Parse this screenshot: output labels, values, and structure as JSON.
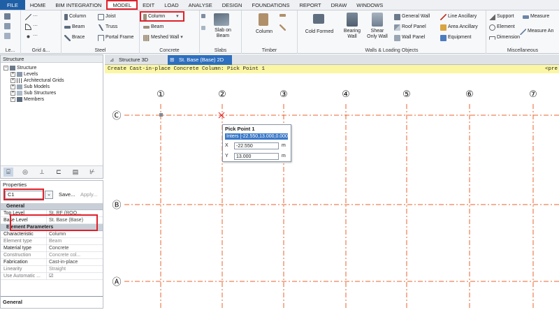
{
  "menu": {
    "tabs": [
      "FILE",
      "HOME",
      "BIM INTEGRATION",
      "MODEL",
      "EDIT",
      "LOAD",
      "ANALYSE",
      "DESIGN",
      "FOUNDATIONS",
      "REPORT",
      "DRAW",
      "WINDOWS"
    ],
    "active": "MODEL"
  },
  "ribbon": {
    "groups": {
      "levels": "Le...",
      "grid": "Grid &...",
      "steel": "Steel",
      "concrete": "Concrete",
      "slabs": "Slabs",
      "timber": "Timber",
      "walls": "Walls & Loading Objects",
      "misc": "Miscellaneous"
    },
    "steel": {
      "column": "Column",
      "beam": "Beam",
      "brace": "Brace",
      "joist": "Joist",
      "truss": "Truss",
      "portal": "Portal Frame"
    },
    "concrete": {
      "column": "Column",
      "beam": "Beam",
      "wall": "Meshed Wall"
    },
    "slabs": {
      "slab_on_beam": "Slab on\nBeam"
    },
    "timber": {
      "column": "Column"
    },
    "walls": {
      "cold_formed": "Cold Formed",
      "bearing": "Bearing\nWall",
      "shear": "Shear\nOnly Wall",
      "general_wall": "General Wall",
      "roof_panel": "Roof Panel",
      "wall_panel": "Wall Panel",
      "line_ancillary": "Line Ancillary",
      "area_ancillary": "Area Ancillary",
      "equipment": "Equipment"
    },
    "misc": {
      "support": "Support",
      "element": "Element",
      "dimension": "Dimension",
      "measure": "Measure",
      "measure_an": "Measure An"
    }
  },
  "structure_panel": {
    "title": "Structure",
    "items": [
      "Structure",
      "Levels",
      "Architectural Grids",
      "Sub Models",
      "Sub Structures",
      "Members"
    ]
  },
  "doc_tabs": [
    "Structure 3D",
    "St. Base (Base) 2D"
  ],
  "command": {
    "prompt": "Create Cast-in-place Concrete Column: Pick Point 1",
    "right": "<pre"
  },
  "properties": {
    "title": "Properties",
    "selected": "C1",
    "save": "Save...",
    "apply": "Apply...",
    "sec_general": "General",
    "general": [
      {
        "k": "Top Level",
        "v": "St. RF (ROO..."
      },
      {
        "k": "Base Level",
        "v": "St. Base (Base)"
      }
    ],
    "sec_element": "Element Parameters",
    "element": [
      {
        "k": "Characteristic",
        "v": "Column"
      },
      {
        "k": "Element type",
        "v": "Beam"
      },
      {
        "k": "Material type",
        "v": "Concrete"
      },
      {
        "k": "Construction",
        "v": "Concrete col..."
      },
      {
        "k": "Fabrication",
        "v": "Cast-in-place"
      },
      {
        "k": "Linearity",
        "v": "Straight"
      },
      {
        "k": "Use Automatic ...",
        "v": "☑"
      }
    ],
    "footer": "General"
  },
  "pick_point": {
    "title": "Pick Point 1",
    "inters": "Inters [-22.550,13.000,0.000]m",
    "x_label": "X",
    "x_value": "-22.550",
    "y_label": "Y",
    "y_value": "13.000",
    "unit": "m"
  },
  "grid": {
    "columns": [
      "①",
      "②",
      "③",
      "④",
      "⑤",
      "⑥",
      "⑦"
    ],
    "rows": [
      "Ⓒ",
      "Ⓑ",
      "Ⓐ"
    ]
  },
  "colors": {
    "accent": "#e0202a",
    "grid": "#e8632e",
    "file": "#1f5fa6"
  }
}
